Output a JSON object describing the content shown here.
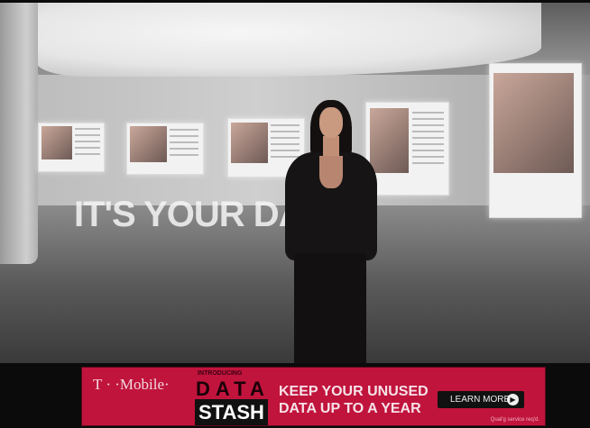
{
  "scene": {
    "headline": "IT'S YOUR DATA."
  },
  "banner": {
    "logo": "T · ·Mobile·",
    "introducing": "INTRODUCING",
    "product_line1": "DATA",
    "product_line2": "STASH",
    "tagline_line1": "KEEP YOUR UNUSED",
    "tagline_line2": "DATA UP TO A YEAR",
    "cta": "LEARN MORE",
    "cta_icon": "play-arrow-circle-icon",
    "fine_print": "Qual'g service req'd.",
    "brand_color": "#c0143c"
  }
}
